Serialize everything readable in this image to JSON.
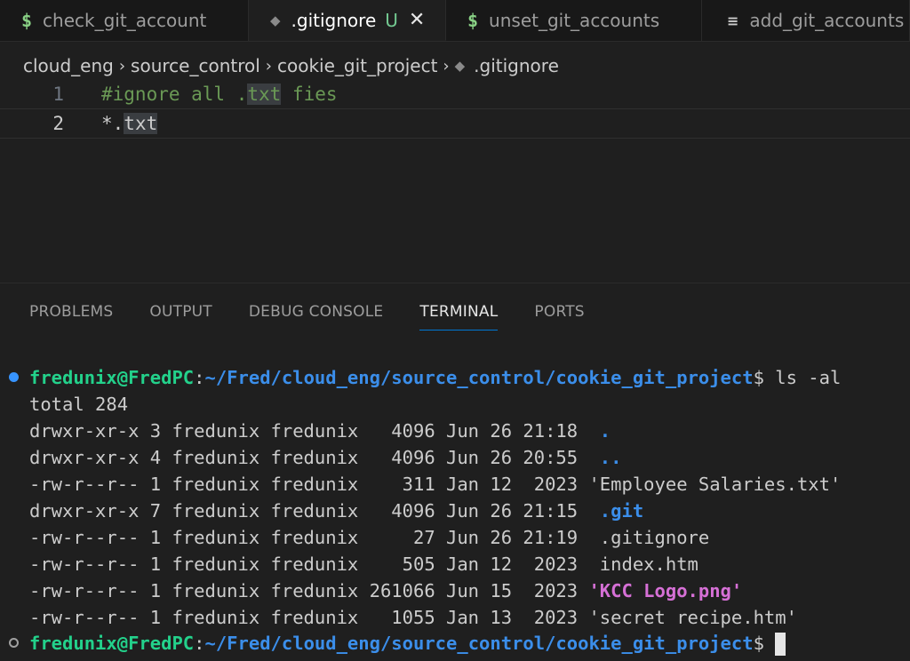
{
  "tabs": [
    {
      "icon": "$",
      "icon_name": "dollar-icon",
      "label": "check_git_account",
      "active": false
    },
    {
      "icon": "◆",
      "icon_name": "git-icon",
      "label": ".gitignore",
      "status": "U",
      "close": "✕",
      "active": true
    },
    {
      "icon": "$",
      "icon_name": "dollar-icon",
      "label": "unset_git_accounts",
      "active": false
    },
    {
      "icon": "≡",
      "icon_name": "lines-icon",
      "label": "add_git_accounts",
      "active": false
    }
  ],
  "breadcrumb": [
    "cloud_eng",
    "source_control",
    "cookie_git_project",
    ".gitignore"
  ],
  "editor": {
    "lines": [
      {
        "num": "1",
        "pre": "#ignore all .",
        "hl": "txt",
        "post": " fies"
      },
      {
        "num": "2",
        "pre": "*.",
        "hl": "txt",
        "post": ""
      }
    ]
  },
  "panel_tabs": [
    "PROBLEMS",
    "OUTPUT",
    "DEBUG CONSOLE",
    "TERMINAL",
    "PORTS"
  ],
  "terminal": {
    "user": "fredunix@FredPC",
    "colon": ":",
    "path": "~/Fred/cloud_eng/source_control/cookie_git_project",
    "prompt_suffix": "$ ",
    "command": "ls -al",
    "total": "total 284",
    "entries": [
      {
        "meta": "drwxr-xr-x 3 fredunix fredunix   4096 Jun 26 21:18  ",
        "name": ".",
        "kind": "dir"
      },
      {
        "meta": "drwxr-xr-x 4 fredunix fredunix   4096 Jun 26 20:55  ",
        "name": "..",
        "kind": "dir"
      },
      {
        "meta": "-rw-r--r-- 1 fredunix fredunix    311 Jan 12  2023 ",
        "name": "'Employee Salaries.txt'",
        "kind": "file"
      },
      {
        "meta": "drwxr-xr-x 7 fredunix fredunix   4096 Jun 26 21:15  ",
        "name": ".git",
        "kind": "dir"
      },
      {
        "meta": "-rw-r--r-- 1 fredunix fredunix     27 Jun 26 21:19  ",
        "name": ".gitignore",
        "kind": "file"
      },
      {
        "meta": "-rw-r--r-- 1 fredunix fredunix    505 Jan 12  2023  ",
        "name": "index.htm",
        "kind": "file"
      },
      {
        "meta": "-rw-r--r-- 1 fredunix fredunix 261066 Jun 15  2023 ",
        "name": "'KCC Logo.png'",
        "kind": "image"
      },
      {
        "meta": "-rw-r--r-- 1 fredunix fredunix   1055 Jan 13  2023 ",
        "name": "'secret recipe.htm'",
        "kind": "file"
      }
    ]
  },
  "colors": {
    "accent": "#0078d4",
    "prompt_user": "#23d18b",
    "prompt_path": "#3b8eea",
    "image_file": "#d670d6",
    "comment": "#6a9955"
  }
}
